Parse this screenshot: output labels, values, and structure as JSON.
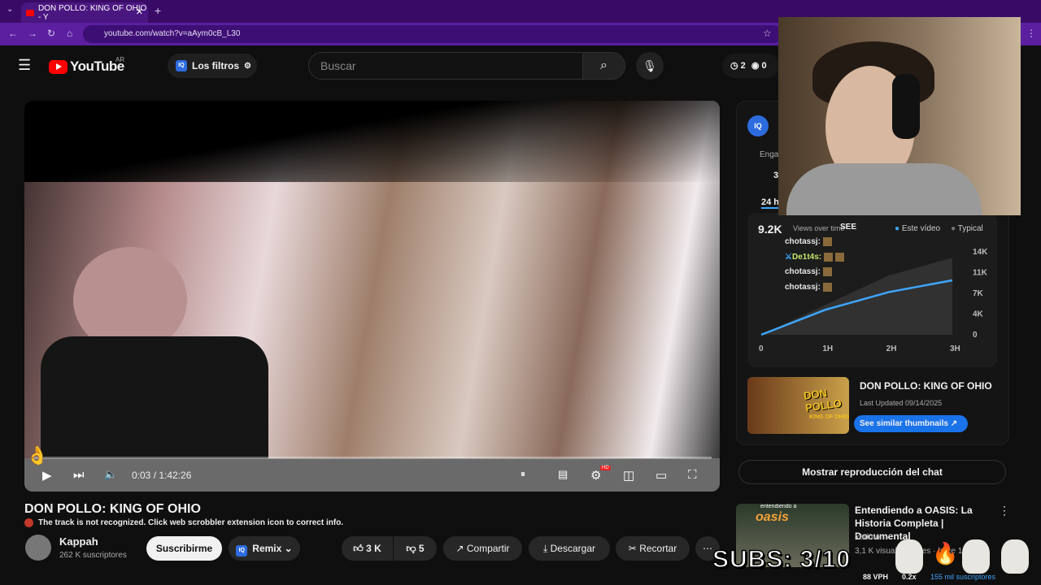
{
  "browser": {
    "tab_title": "DON POLLO: KING OF OHIO - Y",
    "url": "youtube.com/watch?v=aAym0cB_L30"
  },
  "header": {
    "brand": "YouTube",
    "country_code": "AR",
    "filters_label": "Los filtros",
    "search_placeholder": "Buscar",
    "stat_history": "2",
    "stat_views": "0"
  },
  "video": {
    "current_time": "0:03 / 1:42:26",
    "progress": 0.0005,
    "title": "DON POLLO: KING OF OHIO",
    "scrobble_notice": "The track is not recognized. Click web scrobbler extension icon to correct info.",
    "channel": "Kappah",
    "subscribers": "262 K suscriptores",
    "subscribe_label": "Suscribirme",
    "remix_label": "Remix",
    "likes": "3 K",
    "dislikes": "5",
    "share_label": "Compartir",
    "download_label": "Descargar",
    "clip_label": "Recortar",
    "hd_badge": "HD"
  },
  "panel": {
    "engagement_label": "Enga",
    "engagement_value": "3",
    "range_label": "24 h",
    "views_value": "9.2K",
    "views_label": "Views over time",
    "see_label": "SEE",
    "legend_this": "Este vídeo",
    "legend_typical": "Typical",
    "thumb_title": "DON POLLO: KING OF OHIO",
    "thumb_updated": "Last Updated 09/14/2025",
    "thumb_button": "See similar thumbnails",
    "thumb_art_text": "DON POLLO",
    "thumb_art_sub": "KING OF OHIO"
  },
  "chart_data": {
    "type": "line",
    "x": [
      "0",
      "1H",
      "2H",
      "3H"
    ],
    "ylim": [
      0,
      14000
    ],
    "y_ticks": [
      "14K",
      "11K",
      "7K",
      "4K",
      "0"
    ],
    "series": [
      {
        "name": "Este vídeo",
        "values": [
          0,
          4200,
          7200,
          9200
        ],
        "color": "#3ea6ff"
      },
      {
        "name": "Typical",
        "values": [
          0,
          5000,
          10000,
          13000
        ],
        "color": "#5a5a5a"
      }
    ]
  },
  "chat": {
    "messages": [
      {
        "user": "chotassj:"
      },
      {
        "user": "De1t4s:"
      },
      {
        "user": "chotassj:"
      },
      {
        "user": "chotassj:"
      }
    ]
  },
  "sidebar": {
    "chat_replay": "Mostrar reproducción del chat",
    "rec_title": "Entendiendo a OASIS: La Historia Completa | Documental",
    "rec_channel": "Yadmor",
    "rec_meta": "3,1 K visualizaciones · hace 1 día",
    "rec_thumb_text": "oasis",
    "rec_thumb_top": "entendiendo a"
  },
  "overlay": {
    "subs_text": "SUBS:  3/10",
    "vph": "88 VPH",
    "ratio": "0.2x",
    "subs_count": "155 mil suscriptores"
  },
  "colors": {
    "tabbar": "#3a0b66",
    "addrbar": "#5b1fa0",
    "accent": "#3ea6ff",
    "yt_red": "#ff0000"
  }
}
